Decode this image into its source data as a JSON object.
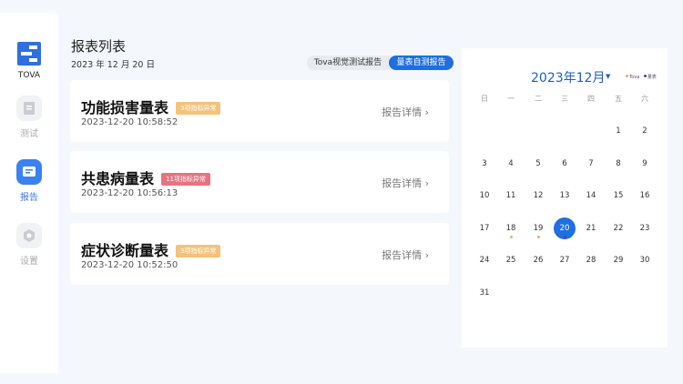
{
  "app": {
    "name": "TOVA"
  },
  "sidebar": {
    "items": [
      {
        "label": "测试",
        "icon": "document-icon"
      },
      {
        "label": "报告",
        "icon": "report-icon",
        "active": true
      },
      {
        "label": "设置",
        "icon": "gear-icon"
      }
    ]
  },
  "header": {
    "title": "报表列表",
    "date": "2023 年 12 月 20 日"
  },
  "tabs": [
    {
      "label": "Tova视觉测试报告"
    },
    {
      "label": "量表自测报告",
      "active": true
    }
  ],
  "reports": [
    {
      "name": "功能损害量表",
      "badge": "3项指标异常",
      "badge_color": "#f5c27a",
      "time": "2023-12-20 10:58:52",
      "detail": "报告详情 ›"
    },
    {
      "name": "共患病量表",
      "badge": "11项指标异常",
      "badge_color": "#e8737f",
      "time": "2023-12-20 10:56:13",
      "detail": "报告详情 ›"
    },
    {
      "name": "症状诊断量表",
      "badge": "3项指标异常",
      "badge_color": "#f5c27a",
      "time": "2023-12-20 10:52:50",
      "detail": "报告详情 ›"
    }
  ],
  "calendar": {
    "title": "2023年12月",
    "legend": [
      {
        "label": "Tova",
        "color": "#f0b050"
      },
      {
        "label": "量表",
        "color": "#4a3fb0"
      }
    ],
    "weekdays": [
      "日",
      "一",
      "二",
      "三",
      "四",
      "五",
      "六"
    ],
    "first_weekday": 5,
    "days": 31,
    "selected": 20,
    "marks": {
      "18": "#f0b050",
      "19": "#f0b050",
      "20": "#4a3fb0"
    }
  }
}
